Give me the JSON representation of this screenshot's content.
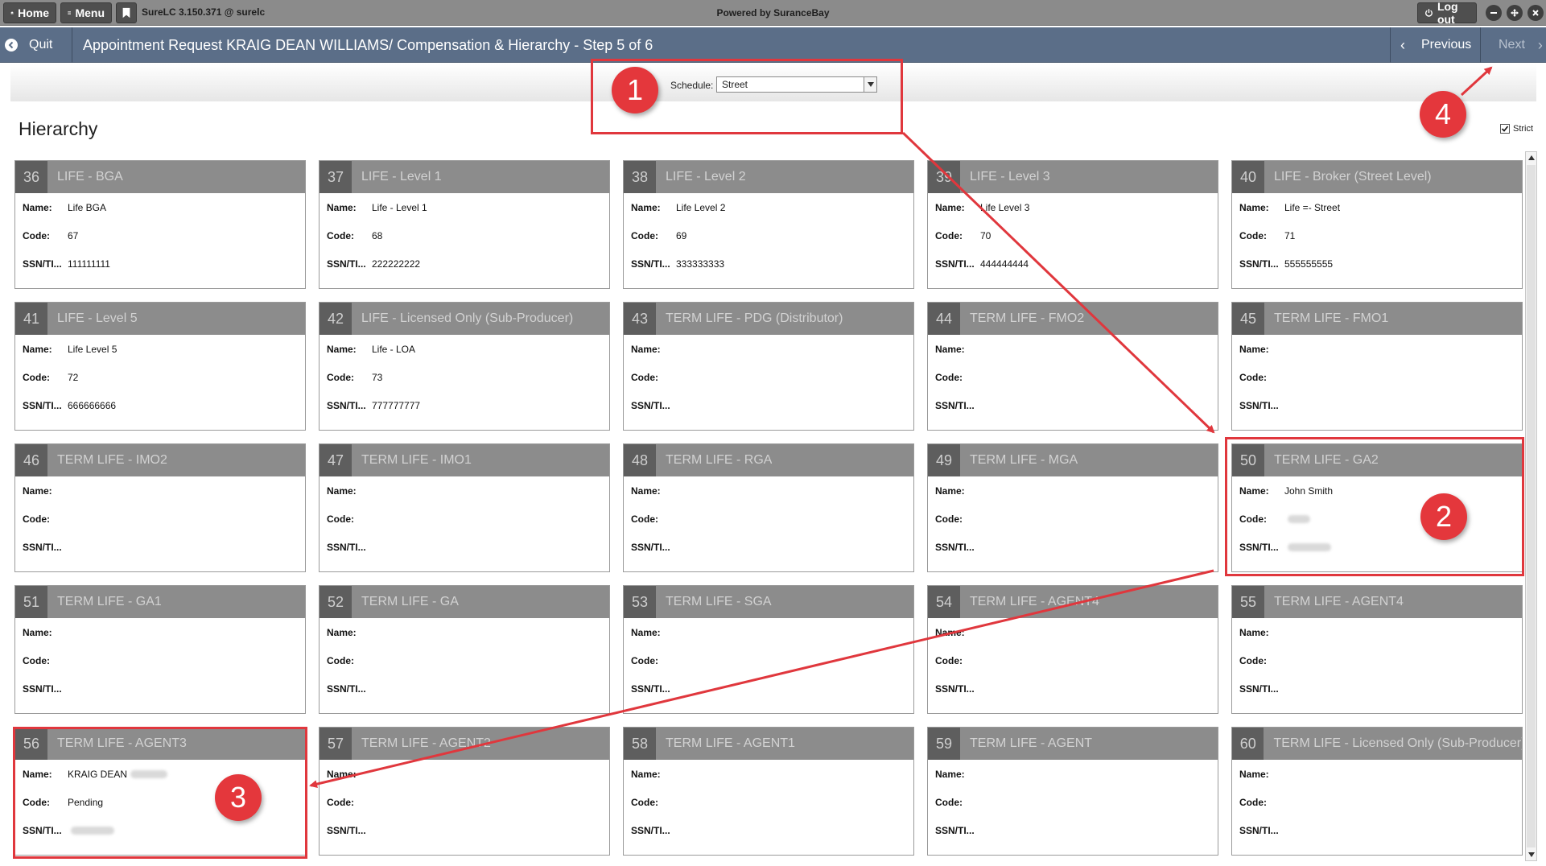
{
  "topbar": {
    "home_label": "Home",
    "menu_label": "Menu",
    "app_version": "SureLC 3.150.371 @ surelc",
    "powered_by": "Powered by SuranceBay",
    "logout_label": "Log out",
    "icons": [
      "home-icon",
      "menu-icon",
      "bookmark-icon",
      "power-icon",
      "minimize-icon",
      "maximize-icon",
      "close-icon"
    ]
  },
  "stepbar": {
    "quit_label": "Quit",
    "title": "Appointment Request KRAIG DEAN WILLIAMS/ Compensation & Hierarchy - Step 5 of 6",
    "previous_label": "Previous",
    "next_label": "Next"
  },
  "schedule": {
    "label": "Schedule:",
    "value": "Street"
  },
  "hierarchy": {
    "title": "Hierarchy",
    "strict_label": "Strict",
    "strict_checked": true,
    "field_labels": {
      "name": "Name:",
      "code": "Code:",
      "ssn": "SSN/TI..."
    },
    "cards": [
      {
        "num": "36",
        "title": "LIFE - BGA",
        "name": "Life BGA",
        "code": "67",
        "ssn": "111111111"
      },
      {
        "num": "37",
        "title": "LIFE - Level 1",
        "name": "Life - Level 1",
        "code": "68",
        "ssn": "222222222"
      },
      {
        "num": "38",
        "title": "LIFE - Level 2",
        "name": "Life Level 2",
        "code": "69",
        "ssn": "333333333"
      },
      {
        "num": "39",
        "title": "LIFE - Level 3",
        "name": "Life Level 3",
        "code": "70",
        "ssn": "444444444"
      },
      {
        "num": "40",
        "title": "LIFE - Broker (Street Level)",
        "name": "Life =- Street",
        "code": "71",
        "ssn": "555555555"
      },
      {
        "num": "41",
        "title": "LIFE - Level 5",
        "name": "Life Level 5",
        "code": "72",
        "ssn": "666666666"
      },
      {
        "num": "42",
        "title": "LIFE - Licensed Only (Sub-Producer)",
        "name": "Life - LOA",
        "code": "73",
        "ssn": "777777777"
      },
      {
        "num": "43",
        "title": "TERM LIFE - PDG (Distributor)",
        "name": "",
        "code": "",
        "ssn": ""
      },
      {
        "num": "44",
        "title": "TERM LIFE - FMO2",
        "name": "",
        "code": "",
        "ssn": ""
      },
      {
        "num": "45",
        "title": "TERM LIFE - FMO1",
        "name": "",
        "code": "",
        "ssn": ""
      },
      {
        "num": "46",
        "title": "TERM LIFE - IMO2",
        "name": "",
        "code": "",
        "ssn": ""
      },
      {
        "num": "47",
        "title": "TERM LIFE - IMO1",
        "name": "",
        "code": "",
        "ssn": ""
      },
      {
        "num": "48",
        "title": "TERM LIFE - RGA",
        "name": "",
        "code": "",
        "ssn": ""
      },
      {
        "num": "49",
        "title": "TERM LIFE - MGA",
        "name": "",
        "code": "",
        "ssn": ""
      },
      {
        "num": "50",
        "title": "TERM LIFE - GA2",
        "name": "John Smith",
        "code": "",
        "ssn": "",
        "code_redacted": true,
        "ssn_redacted": true
      },
      {
        "num": "51",
        "title": "TERM LIFE - GA1",
        "name": "",
        "code": "",
        "ssn": ""
      },
      {
        "num": "52",
        "title": "TERM LIFE - GA",
        "name": "",
        "code": "",
        "ssn": ""
      },
      {
        "num": "53",
        "title": "TERM LIFE - SGA",
        "name": "",
        "code": "",
        "ssn": ""
      },
      {
        "num": "54",
        "title": "TERM LIFE - AGENT4",
        "name": "",
        "code": "",
        "ssn": ""
      },
      {
        "num": "55",
        "title": "TERM LIFE - AGENT4",
        "name": "",
        "code": "",
        "ssn": ""
      },
      {
        "num": "56",
        "title": "TERM LIFE - AGENT3",
        "name": "KRAIG DEAN",
        "code": "Pending",
        "ssn": "",
        "name_redacted": true,
        "ssn_redacted": true
      },
      {
        "num": "57",
        "title": "TERM LIFE - AGENT2",
        "name": "",
        "code": "",
        "ssn": ""
      },
      {
        "num": "58",
        "title": "TERM LIFE - AGENT1",
        "name": "",
        "code": "",
        "ssn": ""
      },
      {
        "num": "59",
        "title": "TERM LIFE - AGENT",
        "name": "",
        "code": "",
        "ssn": ""
      },
      {
        "num": "60",
        "title": "TERM LIFE - Licensed Only (Sub-Producer)",
        "name": "",
        "code": "",
        "ssn": ""
      }
    ]
  },
  "annotations": {
    "color": "#e0373d",
    "badges": [
      "1",
      "2",
      "3",
      "4"
    ]
  }
}
